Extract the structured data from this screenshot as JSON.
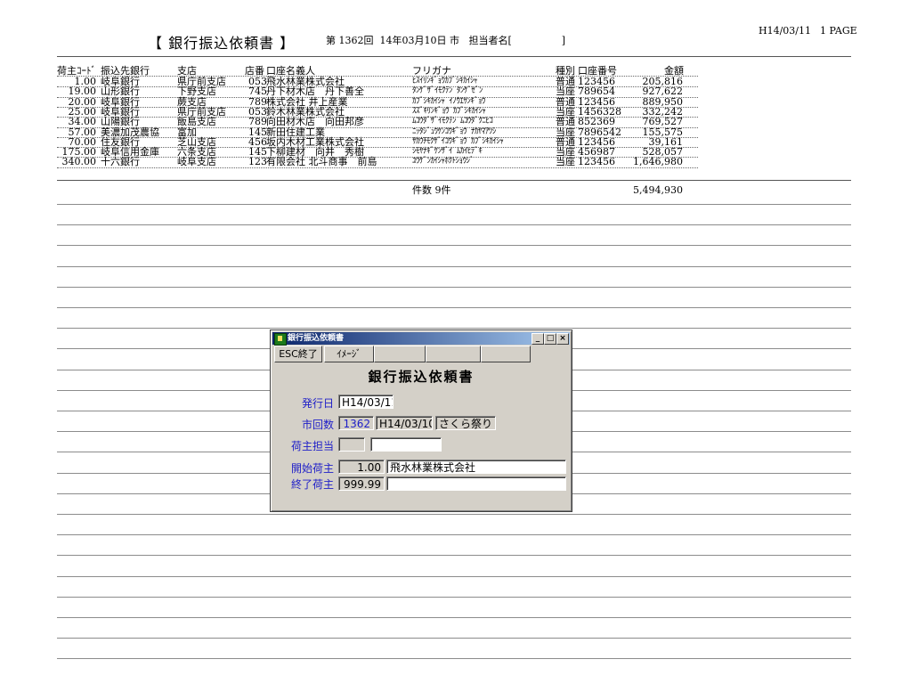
{
  "report": {
    "title": "【 銀行振込依頼書 】",
    "meta": "第 1362回  14年03月10日 市   担当者名[                ]",
    "date": "H14/03/11",
    "page": "1 PAGE",
    "headers": {
      "code": "荷主ｺｰﾄﾞ",
      "bank": "振込先銀行",
      "branch": "支店",
      "store": "店番",
      "holder": "口座名義人",
      "kana": "フリガナ",
      "type": "種別",
      "account": "口座番号",
      "amount": "金額"
    },
    "rows": [
      {
        "code": "1.00",
        "bank": "岐阜銀行",
        "branch": "県庁前支店",
        "store": "053",
        "holder": "飛水林業株式会社",
        "kana": "ﾋｽｲﾘﾝｷﾞｮｳｶﾌﾞｼｷｶｲｼｬ",
        "type": "普通",
        "account": "123456",
        "amount": "205,816"
      },
      {
        "code": "19.00",
        "bank": "山形銀行",
        "branch": "下野支店",
        "store": "745",
        "holder": "丹下材木店　丹下善全",
        "kana": "ﾀﾝｹﾞｻﾞｲﾓｸﾃﾝ ﾀﾝｹﾞｾﾞﾝ",
        "type": "当座",
        "account": "789654",
        "amount": "927,622"
      },
      {
        "code": "20.00",
        "bank": "岐阜銀行",
        "branch": "蕨支店",
        "store": "789",
        "holder": "株式会社 井上産業",
        "kana": "ｶﾌﾞｼｷｶｲｼｬ ｲﾉｳｴｻﾝｷﾞｮｳ",
        "type": "普通",
        "account": "123456",
        "amount": "889,950"
      },
      {
        "code": "25.00",
        "bank": "岐阜銀行",
        "branch": "県庁前支店",
        "store": "053",
        "holder": "鈴木林業株式会社",
        "kana": "ｽｽﾞｷﾘﾝｷﾞｮｳ ｶﾌﾞｼｷｶｲｼｬ",
        "type": "当座",
        "account": "1456328",
        "amount": "332,242"
      },
      {
        "code": "34.00",
        "bank": "山陽銀行",
        "branch": "飯島支店",
        "store": "789",
        "holder": "向田材木店　向田邦彦",
        "kana": "ﾑｺｳﾀﾞｻﾞｲﾓｸﾃﾝ ﾑｺｳﾀﾞｸﾆﾋｺ",
        "type": "普通",
        "account": "852369",
        "amount": "769,527"
      },
      {
        "code": "57.00",
        "bank": "美濃加茂農協",
        "branch": "富加",
        "store": "145",
        "holder": "新田住建工業",
        "kana": "ﾆｯﾀｼﾞｭｳｹﾝｺｳｷﾞｮｳ ﾅｶﾔﾏｱﾂｼ",
        "type": "当座",
        "account": "7896542",
        "amount": "155,575"
      },
      {
        "code": "70.00",
        "bank": "住友銀行",
        "branch": "芝山支店",
        "store": "456",
        "holder": "坂内木材工業株式会社",
        "kana": "ｻｶｳﾁﾓｸｻﾞｲｺｳｷﾞｮｳ ｶﾌﾞｼｷｶｲｼｬ",
        "type": "普通",
        "account": "123456",
        "amount": "39,161"
      },
      {
        "code": "175.00",
        "bank": "岐阜信用金庫",
        "branch": "六条支店",
        "store": "145",
        "holder": "下柳建材　向井　秀樹",
        "kana": "ｼﾓﾔﾅｷﾞｹﾝｻﾞｲ ﾑｶｲﾋﾃﾞｷ",
        "type": "当座",
        "account": "456987",
        "amount": "528,057"
      },
      {
        "code": "340.00",
        "bank": "十六銀行",
        "branch": "岐阜支店",
        "store": "123",
        "holder": "有限会社 北斗商事　前島",
        "kana": "ﾕｳｹﾞﾝｶｲｼｬﾎｸﾄｼｮｳｼﾞ",
        "type": "当座",
        "account": "123456",
        "amount": "1,646,980"
      }
    ],
    "count_label": "件数 9件",
    "total": "5,494,930"
  },
  "dialog": {
    "title": "銀行振込依頼書",
    "buttons": {
      "esc": "ESC終了",
      "image": "ｲﾒｰｼﾞ",
      "minimize": "_",
      "maximize": "□",
      "close": "×"
    },
    "heading": "銀行振込依頼書",
    "issue_label": "発行日",
    "issue_value": "H14/03/11",
    "round_label": "市回数",
    "round_value": "1362",
    "round_date": "H14/03/10",
    "round_name": "さくら祭り",
    "owner_label": "荷主担当",
    "owner_code": "",
    "owner_name": "",
    "start_label": "開始荷主",
    "start_code": "1.00",
    "start_name": "飛水林業株式会社",
    "end_label": "終了荷主",
    "end_code": "999.99",
    "end_name": ""
  }
}
